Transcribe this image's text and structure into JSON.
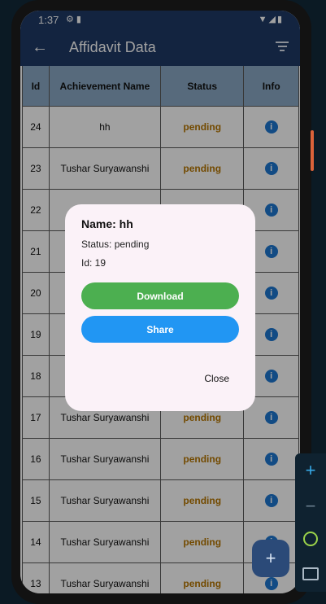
{
  "status_bar": {
    "time": "1:37",
    "left_icons": "⚙ ▮",
    "right_icons": "▼◢▮"
  },
  "app_bar": {
    "title": "Affidavit Data"
  },
  "table": {
    "headers": [
      "Id",
      "Achievement Name",
      "Status",
      "Info"
    ],
    "rows": [
      {
        "id": "24",
        "name": "hh",
        "status": "pending"
      },
      {
        "id": "23",
        "name": "Tushar Suryawanshi",
        "status": "pending"
      },
      {
        "id": "22",
        "name": "Tu",
        "status": ""
      },
      {
        "id": "21",
        "name": "",
        "status": ""
      },
      {
        "id": "20",
        "name": "",
        "status": ""
      },
      {
        "id": "19",
        "name": "",
        "status": ""
      },
      {
        "id": "18",
        "name": "T",
        "status": ""
      },
      {
        "id": "17",
        "name": "Tushar Suryawanshi",
        "status": "pending"
      },
      {
        "id": "16",
        "name": "Tushar Suryawanshi",
        "status": "pending"
      },
      {
        "id": "15",
        "name": "Tushar Suryawanshi",
        "status": "pending"
      },
      {
        "id": "14",
        "name": "Tushar Suryawanshi",
        "status": "pending"
      },
      {
        "id": "13",
        "name": "Tushar Suryawanshi",
        "status": "pending"
      }
    ]
  },
  "dialog": {
    "name": "Name: hh",
    "status": "Status: pending",
    "id": "Id: 19",
    "download_label": "Download",
    "share_label": "Share",
    "close_label": "Close"
  },
  "fab": {
    "symbol": "+"
  },
  "zoom_controls": {
    "plus": "+",
    "minus": "−"
  },
  "colors": {
    "app_bar": "#1f3a66",
    "table_header": "#8aa9c4",
    "pending": "#b77600",
    "info_icon": "#1e78d2",
    "download_button": "#4caf50",
    "share_button": "#2196f3",
    "dialog_bg": "#fbf2f8"
  },
  "icons": [
    "back-arrow-icon",
    "filter-icon",
    "info-icon",
    "settings-icon",
    "sd-card-icon",
    "wifi-icon",
    "signal-icon",
    "battery-icon",
    "zoom-in-icon",
    "zoom-out-icon",
    "magnifier-icon",
    "fit-screen-icon"
  ]
}
